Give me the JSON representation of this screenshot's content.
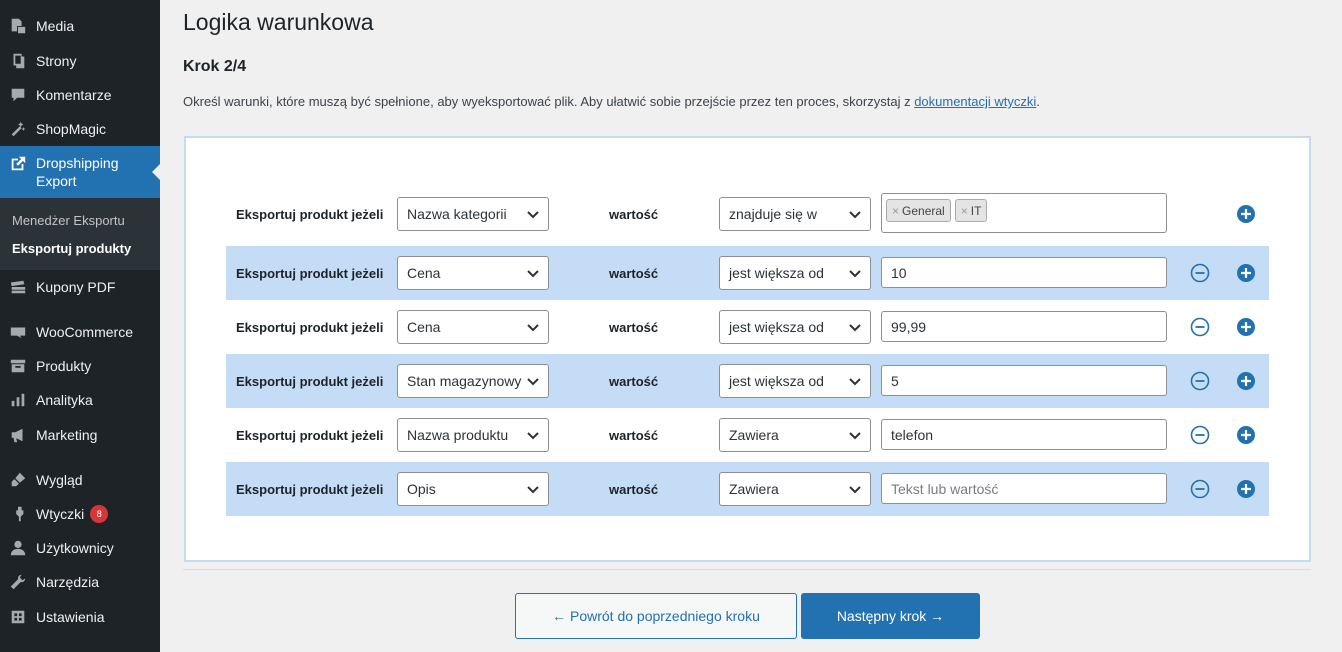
{
  "sidebar": {
    "media": "Media",
    "strony": "Strony",
    "komentarze": "Komentarze",
    "shopmagic": "ShopMagic",
    "dropshipping": "Dropshipping Export",
    "submenu": {
      "menedzer": "Menedżer Eksportu",
      "eksportuj": "Eksportuj produkty"
    },
    "kupony": "Kupony PDF",
    "woocommerce": "WooCommerce",
    "produkty": "Produkty",
    "analityka": "Analityka",
    "marketing": "Marketing",
    "wyglad": "Wygląd",
    "wtyczki": "Wtyczki",
    "wtyczki_badge": "8",
    "uzytkownicy": "Użytkownicy",
    "narzedzia": "Narzędzia",
    "ustawienia": "Ustawienia"
  },
  "page": {
    "title": "Logika warunkowa",
    "step": "Krok 2/4",
    "description": "Określ warunki, które muszą być spełnione, aby wyeksportować plik. Aby ułatwić sobie przejście przez ten proces, skorzystaj z ",
    "link": "dokumentacji wtyczki",
    "description_end": "."
  },
  "rows": [
    {
      "label": "Eksportuj produkt jeżeli",
      "field": "Nazwa kategorii",
      "value_label": "wartość",
      "operator": "znajduje się w",
      "tags": [
        "General",
        "IT"
      ]
    },
    {
      "label": "Eksportuj produkt jeżeli",
      "field": "Cena",
      "value_label": "wartość",
      "operator": "jest większa od",
      "value": "10"
    },
    {
      "label": "Eksportuj produkt jeżeli",
      "field": "Cena",
      "value_label": "wartość",
      "operator": "jest większa od",
      "value": "99,99"
    },
    {
      "label": "Eksportuj produkt jeżeli",
      "field": "Stan magazynowy",
      "value_label": "wartość",
      "operator": "jest większa od",
      "value": "5"
    },
    {
      "label": "Eksportuj produkt jeżeli",
      "field": "Nazwa produktu",
      "value_label": "wartość",
      "operator": "Zawiera",
      "value": "telefon"
    },
    {
      "label": "Eksportuj produkt jeżeli",
      "field": "Opis",
      "value_label": "wartość",
      "operator": "Zawiera",
      "placeholder": "Tekst lub wartość"
    }
  ],
  "tag_remove": "×",
  "buttons": {
    "back": "← Powrót do poprzedniego kroku",
    "next": "Następny krok →"
  },
  "icons": {
    "media": "media-icon",
    "strony": "pages-icon",
    "komentarze": "comments-icon",
    "shopmagic": "wand-icon",
    "dropshipping": "external-link-icon",
    "kupony": "coupons-icon",
    "woocommerce": "woo-icon",
    "produkty": "archive-icon",
    "analityka": "bar-chart-icon",
    "marketing": "megaphone-icon",
    "wyglad": "brush-icon",
    "wtyczki": "plugin-icon",
    "uzytkownicy": "user-icon",
    "narzedzia": "wrench-icon",
    "ustawienia": "settings-icon",
    "remove": "minus-circle-icon",
    "add": "plus-circle-icon",
    "dropdown": "chevron-down-icon"
  },
  "colors": {
    "sidebar_bg": "#1d2327",
    "accent": "#2271b1",
    "row_stripe": "#c5dcf6",
    "badge": "#d63638",
    "add_icon": "#2271b1"
  }
}
